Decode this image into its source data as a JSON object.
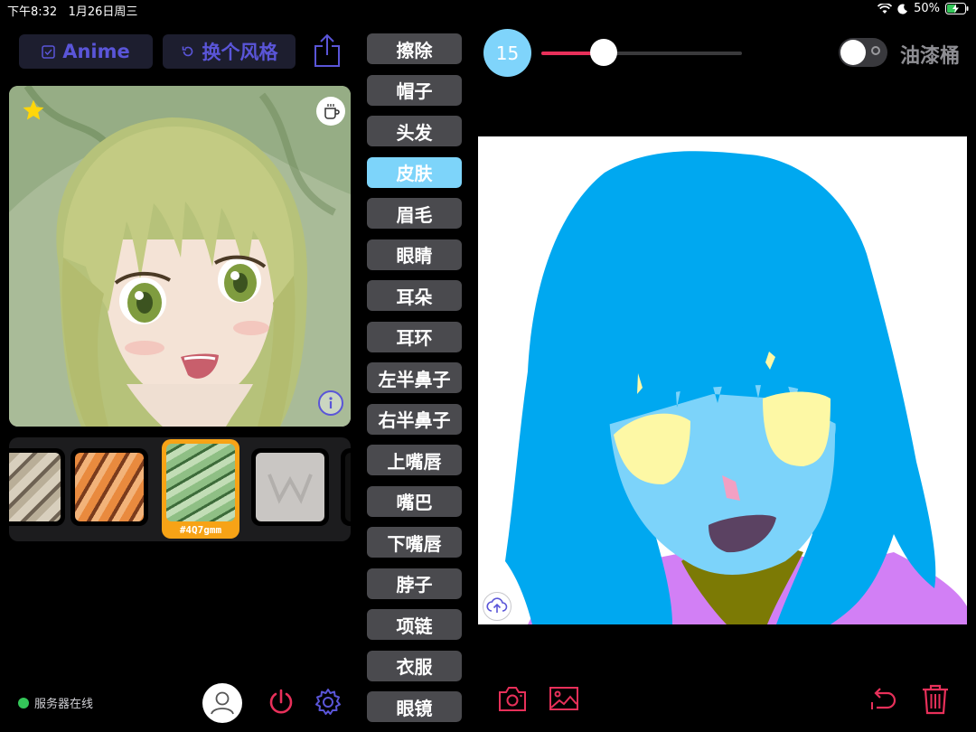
{
  "status_bar": {
    "time": "下午8:32",
    "date": "1月26日周三",
    "battery": "50%"
  },
  "toolbar": {
    "style_label": "Anime",
    "change_style_label": "换个风格"
  },
  "thumbnails": [
    {
      "label": ""
    },
    {
      "label": ""
    },
    {
      "label": "#4Q7gmm",
      "selected": true
    },
    {
      "label": ""
    }
  ],
  "categories": [
    "擦除",
    "帽子",
    "头发",
    "皮肤",
    "眉毛",
    "眼睛",
    "耳朵",
    "耳环",
    "左半鼻子",
    "右半鼻子",
    "上嘴唇",
    "嘴巴",
    "下嘴唇",
    "脖子",
    "项链",
    "衣服",
    "眼镜"
  ],
  "active_category": "皮肤",
  "brush": {
    "size": "15",
    "level": 0.31
  },
  "fill_toggle": {
    "label": "油漆桶",
    "on": false
  },
  "server": {
    "status": "服务器在线"
  },
  "colors": {
    "accent_blue": "#7fd4fb",
    "accent_red": "#e8305a",
    "purple": "#5a55d8",
    "hair": "#00a8f0",
    "skin": "#7cd3fa",
    "eyes": "#fdf8a5",
    "clothes": "#d27ff5",
    "neck": "#7c7a05",
    "mouth": "#5b4262",
    "nose": "#f2a0c3",
    "online": "#34c759",
    "selected_thumb": "#f7a316"
  }
}
